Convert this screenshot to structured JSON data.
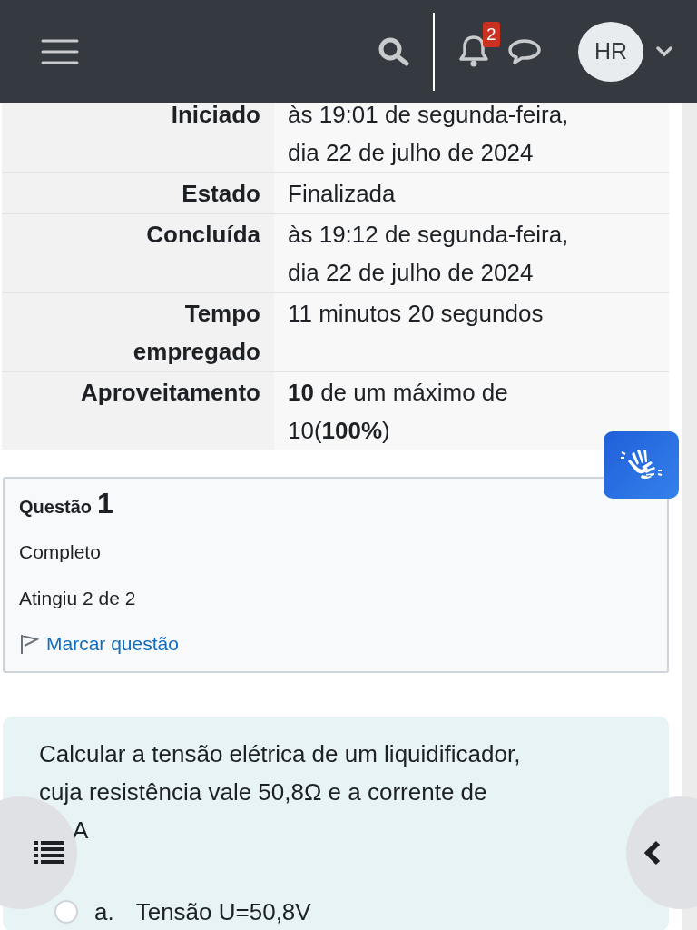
{
  "navbar": {
    "notification_count": "2",
    "avatar_initials": "HR"
  },
  "summary": [
    {
      "label": "Iniciado",
      "value": "às 19:01 de segunda-feira, dia 22 de julho de 2024"
    },
    {
      "label": "Estado",
      "value": "Finalizada"
    },
    {
      "label": "Concluída",
      "value": "às 19:12 de segunda-feira, dia 22 de julho de 2024"
    },
    {
      "label": "Tempo empregado",
      "value": "11 minutos 20 segundos"
    },
    {
      "label": "Aproveitamento",
      "value": "**10** de um máximo de 10(**100%**)"
    }
  ],
  "question_info": {
    "title": "Questão",
    "number": "1",
    "state": "Completo",
    "grade": "Atingiu 2 de 2",
    "flag_link": "Marcar questão"
  },
  "question": {
    "text": "Calcular a tensão elétrica de um liquidificador, cuja resistência vale 50,8Ω e a corrente de",
    "text_end": "A",
    "options": [
      {
        "letter": "a.",
        "text": "Tensão U=50,8V",
        "selected": false
      }
    ]
  }
}
